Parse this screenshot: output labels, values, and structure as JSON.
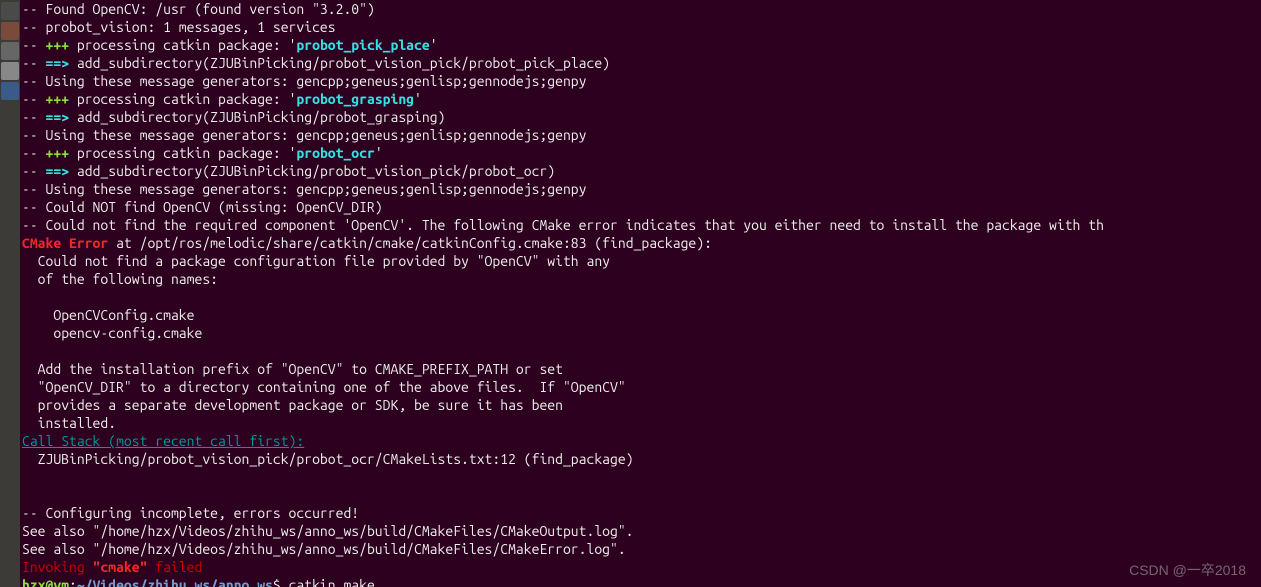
{
  "launcher": {
    "icons": [
      "dash",
      "files",
      "terminal",
      "settings",
      "software"
    ]
  },
  "terminal": {
    "lines": [
      {
        "segments": [
          {
            "t": "-- Found OpenCV: /usr (found version \"3.2.0\")",
            "c": "white"
          }
        ]
      },
      {
        "segments": [
          {
            "t": "-- probot_vision: 1 messages, 1 services",
            "c": "white"
          }
        ]
      },
      {
        "segments": [
          {
            "t": "-- ",
            "c": "white"
          },
          {
            "t": "+++",
            "c": "bold-green"
          },
          {
            "t": " processing catkin package: '",
            "c": "white"
          },
          {
            "t": "probot_pick_place",
            "c": "bold-cyan"
          },
          {
            "t": "'",
            "c": "white"
          }
        ]
      },
      {
        "segments": [
          {
            "t": "-- ",
            "c": "white"
          },
          {
            "t": "==>",
            "c": "bold-cyan"
          },
          {
            "t": " add_subdirectory(ZJUBinPicking/probot_vision_pick/probot_pick_place)",
            "c": "white"
          }
        ]
      },
      {
        "segments": [
          {
            "t": "-- Using these message generators: gencpp;geneus;genlisp;gennodejs;genpy",
            "c": "white"
          }
        ]
      },
      {
        "segments": [
          {
            "t": "-- ",
            "c": "white"
          },
          {
            "t": "+++",
            "c": "bold-green"
          },
          {
            "t": " processing catkin package: '",
            "c": "white"
          },
          {
            "t": "probot_grasping",
            "c": "bold-cyan"
          },
          {
            "t": "'",
            "c": "white"
          }
        ]
      },
      {
        "segments": [
          {
            "t": "-- ",
            "c": "white"
          },
          {
            "t": "==>",
            "c": "bold-cyan"
          },
          {
            "t": " add_subdirectory(ZJUBinPicking/probot_grasping)",
            "c": "white"
          }
        ]
      },
      {
        "segments": [
          {
            "t": "-- Using these message generators: gencpp;geneus;genlisp;gennodejs;genpy",
            "c": "white"
          }
        ]
      },
      {
        "segments": [
          {
            "t": "-- ",
            "c": "white"
          },
          {
            "t": "+++",
            "c": "bold-green"
          },
          {
            "t": " processing catkin package: '",
            "c": "white"
          },
          {
            "t": "probot_ocr",
            "c": "bold-cyan"
          },
          {
            "t": "'",
            "c": "white"
          }
        ]
      },
      {
        "segments": [
          {
            "t": "-- ",
            "c": "white"
          },
          {
            "t": "==>",
            "c": "bold-cyan"
          },
          {
            "t": " add_subdirectory(ZJUBinPicking/probot_vision_pick/probot_ocr)",
            "c": "white"
          }
        ]
      },
      {
        "segments": [
          {
            "t": "-- Using these message generators: gencpp;geneus;genlisp;gennodejs;genpy",
            "c": "white"
          }
        ]
      },
      {
        "segments": [
          {
            "t": "-- Could NOT find OpenCV (missing: OpenCV_DIR)",
            "c": "white"
          }
        ]
      },
      {
        "segments": [
          {
            "t": "-- Could not find the required component 'OpenCV'. The following CMake error indicates that you either need to install the package with th",
            "c": "white"
          }
        ]
      },
      {
        "segments": [
          {
            "t": "CMake Error",
            "c": "bold-red"
          },
          {
            "t": " at /opt/ros/melodic/share/catkin/cmake/catkinConfig.cmake:83 (find_package):",
            "c": "white"
          }
        ]
      },
      {
        "segments": [
          {
            "t": "  Could not find a package configuration file provided by \"OpenCV\" with any",
            "c": "white"
          }
        ]
      },
      {
        "segments": [
          {
            "t": "  of the following names:",
            "c": "white"
          }
        ]
      },
      {
        "segments": [
          {
            "t": "",
            "c": "white"
          }
        ]
      },
      {
        "segments": [
          {
            "t": "    OpenCVConfig.cmake",
            "c": "white"
          }
        ]
      },
      {
        "segments": [
          {
            "t": "    opencv-config.cmake",
            "c": "white"
          }
        ]
      },
      {
        "segments": [
          {
            "t": "",
            "c": "white"
          }
        ]
      },
      {
        "segments": [
          {
            "t": "  Add the installation prefix of \"OpenCV\" to CMAKE_PREFIX_PATH or set",
            "c": "white"
          }
        ]
      },
      {
        "segments": [
          {
            "t": "  \"OpenCV_DIR\" to a directory containing one of the above files.  If \"OpenCV\"",
            "c": "white"
          }
        ]
      },
      {
        "segments": [
          {
            "t": "  provides a separate development package or SDK, be sure it has been",
            "c": "white"
          }
        ]
      },
      {
        "segments": [
          {
            "t": "  installed.",
            "c": "white"
          }
        ]
      },
      {
        "segments": [
          {
            "t": "Call Stack (most recent call first):",
            "c": "cyan-underline"
          }
        ]
      },
      {
        "segments": [
          {
            "t": "  ZJUBinPicking/probot_vision_pick/probot_ocr/CMakeLists.txt:12 (find_package)",
            "c": "white"
          }
        ]
      },
      {
        "segments": [
          {
            "t": "",
            "c": "white"
          }
        ]
      },
      {
        "segments": [
          {
            "t": "",
            "c": "white"
          }
        ]
      },
      {
        "segments": [
          {
            "t": "-- Configuring incomplete, errors occurred!",
            "c": "white"
          }
        ]
      },
      {
        "segments": [
          {
            "t": "See also \"/home/hzx/Videos/zhihu_ws/anno_ws/build/CMakeFiles/CMakeOutput.log\".",
            "c": "white"
          }
        ]
      },
      {
        "segments": [
          {
            "t": "See also \"/home/hzx/Videos/zhihu_ws/anno_ws/build/CMakeFiles/CMakeError.log\".",
            "c": "white"
          }
        ]
      },
      {
        "segments": [
          {
            "t": "Invoking ",
            "c": "red"
          },
          {
            "t": "\"cmake\"",
            "c": "bold-red"
          },
          {
            "t": " failed",
            "c": "red"
          }
        ]
      },
      {
        "segments": [
          {
            "t": "hzx@vm",
            "c": "prompt-user"
          },
          {
            "t": ":",
            "c": "white"
          },
          {
            "t": "~/Videos/zhihu_ws/anno_ws",
            "c": "prompt-path"
          },
          {
            "t": "$ catkin_make",
            "c": "white"
          }
        ]
      }
    ]
  },
  "watermark": "CSDN @一卒2018"
}
